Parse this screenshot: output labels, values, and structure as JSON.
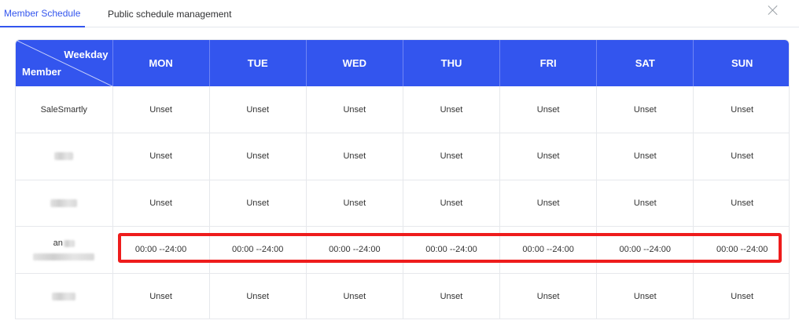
{
  "tabs": [
    {
      "label": "Member Schedule",
      "active": true
    },
    {
      "label": "Public schedule management",
      "active": false
    }
  ],
  "table": {
    "corner": {
      "weekday_label": "Weekday",
      "member_label": "Member"
    },
    "days": [
      "MON",
      "TUE",
      "WED",
      "THU",
      "FRI",
      "SAT",
      "SUN"
    ],
    "rows": [
      {
        "member": "SaleSmartly",
        "cells": [
          "Unset",
          "Unset",
          "Unset",
          "Unset",
          "Unset",
          "Unset",
          "Unset"
        ]
      },
      {
        "member": "",
        "cells": [
          "Unset",
          "Unset",
          "Unset",
          "Unset",
          "Unset",
          "Unset",
          "Unset"
        ]
      },
      {
        "member": "",
        "cells": [
          "Unset",
          "Unset",
          "Unset",
          "Unset",
          "Unset",
          "Unset",
          "Unset"
        ]
      },
      {
        "member": "an",
        "cells": [
          "00:00 --24:00",
          "00:00 --24:00",
          "00:00 --24:00",
          "00:00 --24:00",
          "00:00 --24:00",
          "00:00 --24:00",
          "00:00 --24:00"
        ]
      },
      {
        "member": "",
        "cells": [
          "Unset",
          "Unset",
          "Unset",
          "Unset",
          "Unset",
          "Unset",
          "Unset"
        ]
      }
    ]
  },
  "colors": {
    "accent": "#3355ee",
    "highlight": "#ee1c1c"
  },
  "icons": {
    "close": "close-icon"
  }
}
